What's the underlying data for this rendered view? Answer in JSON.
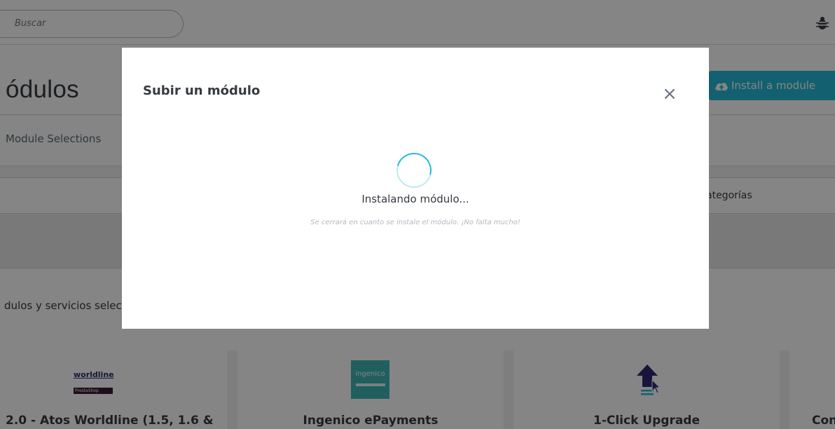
{
  "search": {
    "placeholder": "Buscar"
  },
  "header": {
    "title": "ódulos",
    "install_button": "Install a module"
  },
  "tabs": {
    "module_selections": "Module Selections"
  },
  "filters": {
    "categories": "ategorías"
  },
  "services": {
    "text": "dulos y servicios selec"
  },
  "cards": [
    {
      "name": "2.0 - Atos Worldline (1.5, 1.6 &",
      "logo_text": "worldline",
      "logo_sub": "PrestaShop"
    },
    {
      "name": "Ingenico ePayments",
      "logo_text": "ingenico"
    },
    {
      "name": "1-Click Upgrade"
    },
    {
      "name": "Cond"
    }
  ],
  "modal": {
    "title": "Subir un módulo",
    "close": "×",
    "status": "Instalando módulo...",
    "note": "Se cerrará en cuanto se instale el módulo. ¡No falta mucho!"
  },
  "colors": {
    "accent": "#25b9d7",
    "text": "#363a41"
  },
  "icons": [
    "bug-icon",
    "cloud-upload-icon",
    "close-icon",
    "loading-spinner-icon",
    "upgrade-arrow-icon"
  ]
}
